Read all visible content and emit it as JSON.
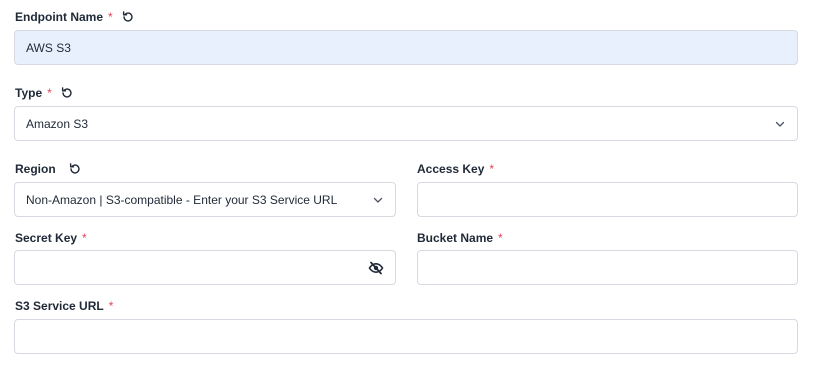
{
  "endpoint_name": {
    "label": "Endpoint Name",
    "required_mark": "*",
    "value": "AWS S3"
  },
  "type": {
    "label": "Type",
    "required_mark": "*",
    "selected": "Amazon S3"
  },
  "region": {
    "label": "Region",
    "selected": "Non-Amazon | S3-compatible - Enter your S3 Service URL"
  },
  "access_key": {
    "label": "Access Key",
    "required_mark": "*",
    "value": ""
  },
  "secret_key": {
    "label": "Secret Key",
    "required_mark": "*",
    "value": ""
  },
  "bucket_name": {
    "label": "Bucket Name",
    "required_mark": "*",
    "value": ""
  },
  "s3_service_url": {
    "label": "S3 Service URL",
    "required_mark": "*",
    "value": ""
  },
  "icons": {
    "reset": "reset-icon",
    "dropdown": "chevron-down-icon",
    "visibility": "eye-slash-icon"
  },
  "colors": {
    "required": "#e0445a",
    "autofill_bg": "#e8f0fe",
    "border": "#d6dae0"
  }
}
